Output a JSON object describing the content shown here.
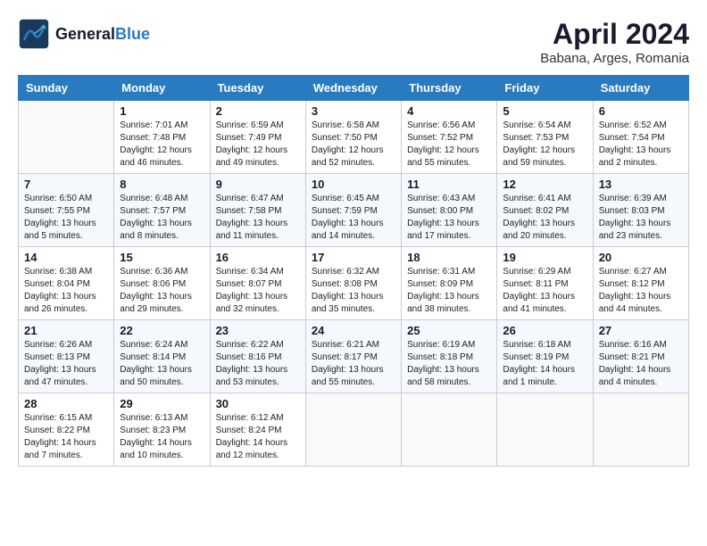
{
  "header": {
    "logo_line1": "General",
    "logo_line2": "Blue",
    "month_year": "April 2024",
    "location": "Babana, Arges, Romania"
  },
  "columns": [
    "Sunday",
    "Monday",
    "Tuesday",
    "Wednesday",
    "Thursday",
    "Friday",
    "Saturday"
  ],
  "weeks": [
    [
      {
        "day": "",
        "info": ""
      },
      {
        "day": "1",
        "info": "Sunrise: 7:01 AM\nSunset: 7:48 PM\nDaylight: 12 hours\nand 46 minutes."
      },
      {
        "day": "2",
        "info": "Sunrise: 6:59 AM\nSunset: 7:49 PM\nDaylight: 12 hours\nand 49 minutes."
      },
      {
        "day": "3",
        "info": "Sunrise: 6:58 AM\nSunset: 7:50 PM\nDaylight: 12 hours\nand 52 minutes."
      },
      {
        "day": "4",
        "info": "Sunrise: 6:56 AM\nSunset: 7:52 PM\nDaylight: 12 hours\nand 55 minutes."
      },
      {
        "day": "5",
        "info": "Sunrise: 6:54 AM\nSunset: 7:53 PM\nDaylight: 12 hours\nand 59 minutes."
      },
      {
        "day": "6",
        "info": "Sunrise: 6:52 AM\nSunset: 7:54 PM\nDaylight: 13 hours\nand 2 minutes."
      }
    ],
    [
      {
        "day": "7",
        "info": "Sunrise: 6:50 AM\nSunset: 7:55 PM\nDaylight: 13 hours\nand 5 minutes."
      },
      {
        "day": "8",
        "info": "Sunrise: 6:48 AM\nSunset: 7:57 PM\nDaylight: 13 hours\nand 8 minutes."
      },
      {
        "day": "9",
        "info": "Sunrise: 6:47 AM\nSunset: 7:58 PM\nDaylight: 13 hours\nand 11 minutes."
      },
      {
        "day": "10",
        "info": "Sunrise: 6:45 AM\nSunset: 7:59 PM\nDaylight: 13 hours\nand 14 minutes."
      },
      {
        "day": "11",
        "info": "Sunrise: 6:43 AM\nSunset: 8:00 PM\nDaylight: 13 hours\nand 17 minutes."
      },
      {
        "day": "12",
        "info": "Sunrise: 6:41 AM\nSunset: 8:02 PM\nDaylight: 13 hours\nand 20 minutes."
      },
      {
        "day": "13",
        "info": "Sunrise: 6:39 AM\nSunset: 8:03 PM\nDaylight: 13 hours\nand 23 minutes."
      }
    ],
    [
      {
        "day": "14",
        "info": "Sunrise: 6:38 AM\nSunset: 8:04 PM\nDaylight: 13 hours\nand 26 minutes."
      },
      {
        "day": "15",
        "info": "Sunrise: 6:36 AM\nSunset: 8:06 PM\nDaylight: 13 hours\nand 29 minutes."
      },
      {
        "day": "16",
        "info": "Sunrise: 6:34 AM\nSunset: 8:07 PM\nDaylight: 13 hours\nand 32 minutes."
      },
      {
        "day": "17",
        "info": "Sunrise: 6:32 AM\nSunset: 8:08 PM\nDaylight: 13 hours\nand 35 minutes."
      },
      {
        "day": "18",
        "info": "Sunrise: 6:31 AM\nSunset: 8:09 PM\nDaylight: 13 hours\nand 38 minutes."
      },
      {
        "day": "19",
        "info": "Sunrise: 6:29 AM\nSunset: 8:11 PM\nDaylight: 13 hours\nand 41 minutes."
      },
      {
        "day": "20",
        "info": "Sunrise: 6:27 AM\nSunset: 8:12 PM\nDaylight: 13 hours\nand 44 minutes."
      }
    ],
    [
      {
        "day": "21",
        "info": "Sunrise: 6:26 AM\nSunset: 8:13 PM\nDaylight: 13 hours\nand 47 minutes."
      },
      {
        "day": "22",
        "info": "Sunrise: 6:24 AM\nSunset: 8:14 PM\nDaylight: 13 hours\nand 50 minutes."
      },
      {
        "day": "23",
        "info": "Sunrise: 6:22 AM\nSunset: 8:16 PM\nDaylight: 13 hours\nand 53 minutes."
      },
      {
        "day": "24",
        "info": "Sunrise: 6:21 AM\nSunset: 8:17 PM\nDaylight: 13 hours\nand 55 minutes."
      },
      {
        "day": "25",
        "info": "Sunrise: 6:19 AM\nSunset: 8:18 PM\nDaylight: 13 hours\nand 58 minutes."
      },
      {
        "day": "26",
        "info": "Sunrise: 6:18 AM\nSunset: 8:19 PM\nDaylight: 14 hours\nand 1 minute."
      },
      {
        "day": "27",
        "info": "Sunrise: 6:16 AM\nSunset: 8:21 PM\nDaylight: 14 hours\nand 4 minutes."
      }
    ],
    [
      {
        "day": "28",
        "info": "Sunrise: 6:15 AM\nSunset: 8:22 PM\nDaylight: 14 hours\nand 7 minutes."
      },
      {
        "day": "29",
        "info": "Sunrise: 6:13 AM\nSunset: 8:23 PM\nDaylight: 14 hours\nand 10 minutes."
      },
      {
        "day": "30",
        "info": "Sunrise: 6:12 AM\nSunset: 8:24 PM\nDaylight: 14 hours\nand 12 minutes."
      },
      {
        "day": "",
        "info": ""
      },
      {
        "day": "",
        "info": ""
      },
      {
        "day": "",
        "info": ""
      },
      {
        "day": "",
        "info": ""
      }
    ]
  ]
}
